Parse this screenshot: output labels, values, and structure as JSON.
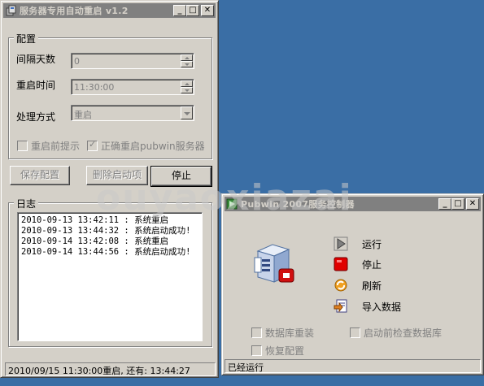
{
  "main_window": {
    "title": "服务器专用自动重启 v1.2",
    "config_group": "配置",
    "interval_label": "间隔天数",
    "interval_value": "0",
    "restart_time_label": "重启时间",
    "restart_time_value": "11:30:00",
    "method_label": "处理方式",
    "method_value": "重启",
    "chk_prompt_label": "重启前提示",
    "chk_prompt_checked": false,
    "chk_restart_pubwin_label": "正确重启pubwin服务器",
    "chk_restart_pubwin_checked": true,
    "btn_save": "保存配置",
    "btn_remove_startup": "删除启动项",
    "btn_stop": "停止",
    "log_group": "日志",
    "log_lines": [
      "2010-09-13 13:42:11 : 系统重启",
      "2010-09-13 13:44:32 : 系统启动成功!",
      "2010-09-14 13:42:08 : 系统重启",
      "2010-09-14 13:44:56 : 系统启动成功!"
    ],
    "status": "2010/09/15 11:30:00重启, 还有: 13:44:27"
  },
  "pubwin_window": {
    "title": "Pubwin 2007服务控制器",
    "actions": [
      {
        "label": "运行",
        "icon": "play-icon"
      },
      {
        "label": "停止",
        "icon": "stop-icon"
      },
      {
        "label": "刷新",
        "icon": "refresh-icon"
      },
      {
        "label": "导入数据",
        "icon": "import-icon"
      }
    ],
    "chk_db_reinstall": "数据库重装",
    "chk_check_db": "启动前检查数据库",
    "chk_restore_config": "恢复配置",
    "status": "已经运行"
  },
  "watermark": "ouyaoxiazai",
  "colors": {
    "desktop": "#3a6ea5",
    "face": "#d4d0c8",
    "inactive_title": "#808080",
    "stop_red": "#e00000"
  }
}
